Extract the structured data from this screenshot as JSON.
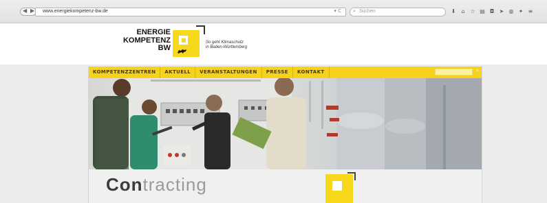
{
  "browser": {
    "url": "www.energiekompetenz-bw.de",
    "search_placeholder": "Suchen",
    "toolbar_icons": [
      "download-icon",
      "home-icon",
      "star-icon",
      "clipboard-icon",
      "pocket-icon",
      "send-icon",
      "sync-icon",
      "extension-icon",
      "menu-icon"
    ]
  },
  "site": {
    "logo_line1": "ENERGIE",
    "logo_line2": "KOMPETENZ",
    "logo_line3": "BW",
    "tagline_line1": "So geht Klimaschutz",
    "tagline_line2": "in Baden-Württemberg",
    "nav": [
      "KOMPETENZZENTREN",
      "AKTUELL",
      "VERANSTALTUNGEN",
      "PRESSE",
      "KONTAKT"
    ],
    "hero_heading_strong": "Con",
    "hero_heading_rest": "tracting"
  },
  "colors": {
    "accent_yellow": "#f6d21d",
    "nav_text": "#4b3a00"
  }
}
